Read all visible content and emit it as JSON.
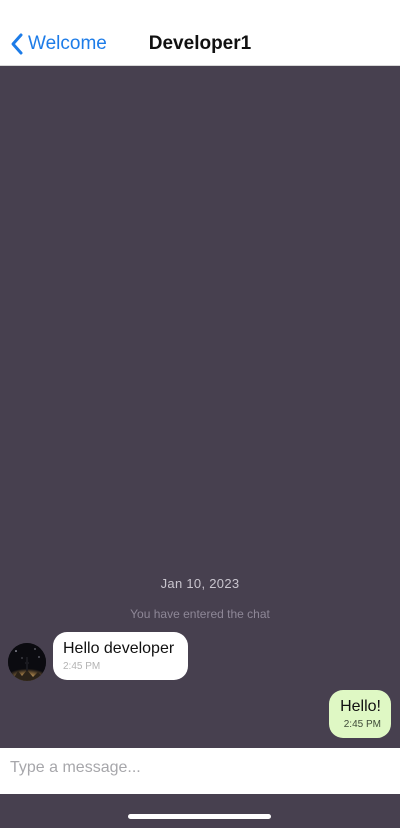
{
  "nav": {
    "back_label": "Welcome",
    "back_icon": "chevron-left-icon",
    "title": "Developer1"
  },
  "chat": {
    "date": "Jan 10, 2023",
    "system_message": "You have entered the chat",
    "messages": [
      {
        "direction": "incoming",
        "text": "Hello developer",
        "time": "2:45 PM"
      },
      {
        "direction": "outgoing",
        "text": "Hello!",
        "time": "2:45 PM"
      }
    ]
  },
  "composer": {
    "placeholder": "Type a message...",
    "value": ""
  },
  "colors": {
    "accent": "#1d7ce8",
    "chat_background": "#47404f",
    "outgoing_bubble": "#dff8c4",
    "incoming_bubble": "#ffffff"
  }
}
